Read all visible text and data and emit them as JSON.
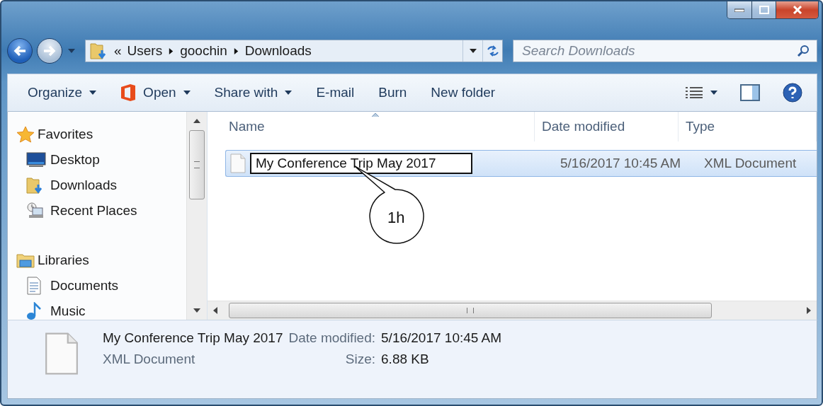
{
  "address_bar": {
    "crumbs": [
      "«",
      "Users",
      "goochin",
      "Downloads"
    ]
  },
  "search": {
    "placeholder": "Search Downloads"
  },
  "toolbar": {
    "buttons": [
      {
        "label": "Organize",
        "kind": "menu"
      },
      {
        "label": "Open",
        "kind": "app"
      },
      {
        "label": "Share with",
        "kind": "menu"
      },
      {
        "label": "E-mail",
        "kind": "plain"
      },
      {
        "label": "Burn",
        "kind": "plain"
      },
      {
        "label": "New folder",
        "kind": "plain"
      }
    ]
  },
  "sidebar": {
    "groups": [
      {
        "label": "Favorites",
        "kind": "star",
        "children": [
          {
            "label": "Desktop",
            "kind": "desktop"
          },
          {
            "label": "Downloads",
            "kind": "downloads"
          },
          {
            "label": "Recent Places",
            "kind": "recent"
          }
        ]
      },
      {
        "label": "Libraries",
        "kind": "library",
        "children": [
          {
            "label": "Documents",
            "kind": "documents"
          },
          {
            "label": "Music",
            "kind": "music"
          }
        ]
      }
    ]
  },
  "file_list": {
    "columns": [
      {
        "label": "Name",
        "sorted": true
      },
      {
        "label": "Date modified",
        "sorted": false
      },
      {
        "label": "Type",
        "sorted": false
      }
    ],
    "rows": [
      {
        "name": "My Conference Trip May 2017",
        "date": "5/16/2017 10:45 AM",
        "type": "XML Document",
        "selected": true,
        "renaming": true
      }
    ]
  },
  "callout": {
    "label": "1h"
  },
  "details": {
    "name": "My Conference Trip May 2017",
    "type": "XML Document",
    "fields": [
      {
        "label": "Date modified:",
        "value": "5/16/2017 10:45 AM"
      },
      {
        "label": "Size:",
        "value": "6.88 KB"
      }
    ]
  }
}
